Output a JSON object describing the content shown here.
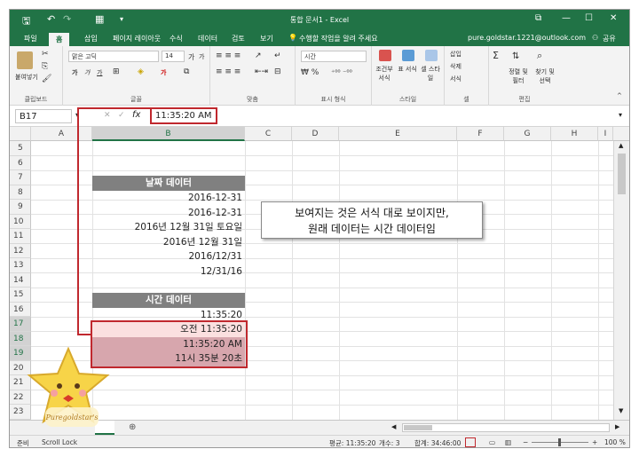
{
  "title_bar": {
    "document_title": "통합 문서1 - Excel",
    "window_buttons": [
      "restore-icon",
      "minimize-icon",
      "maximize-icon",
      "close-icon"
    ]
  },
  "ribbon_tabs": {
    "file": "파일",
    "home": "홈",
    "insert": "삽입",
    "layout": "페이지 레이아웃",
    "formulas": "수식",
    "data": "데이터",
    "review": "검토",
    "view": "보기",
    "tell_me": "수행할 작업을 알려 주세요",
    "account": "pure.goldstar.1221@outlook.com",
    "share": "공유"
  },
  "ribbon": {
    "clipboard": {
      "paste": "붙여넣기",
      "label": "클립보드"
    },
    "font": {
      "font_name": "맑은 고딕",
      "font_size": "14",
      "label": "글꼴",
      "bold": "가",
      "italic": "가",
      "underline": "가",
      "strike": "가",
      "grow": "가",
      "shrink": "가"
    },
    "alignment": {
      "label": "맞춤"
    },
    "number": {
      "format": "시간",
      "label": "표시 형식"
    },
    "styles": {
      "conditional": "조건부 서식",
      "table": "표 서식",
      "cell_styles": "셀 스타일",
      "label": "스타일"
    },
    "cells": {
      "insert": "삽입",
      "delete": "삭제",
      "format": "서식",
      "label": "셀"
    },
    "editing": {
      "sort": "정렬 및 필터",
      "find": "찾기 및 선택",
      "label": "편집"
    }
  },
  "formula_bar": {
    "name_box": "B17",
    "fx": "fx",
    "value": "11:35:20 AM"
  },
  "columns": [
    "A",
    "B",
    "C",
    "D",
    "E",
    "F",
    "G",
    "H",
    "I"
  ],
  "rows": [
    "5",
    "6",
    "7",
    "8",
    "9",
    "10",
    "11",
    "12",
    "13",
    "14",
    "15",
    "16",
    "17",
    "18",
    "19",
    "20",
    "21",
    "22",
    "23"
  ],
  "cells": {
    "r7": "날짜 데이터",
    "r8": "2016-12-31",
    "r9": "2016-12-31",
    "r10": "2016년 12월 31일 토요일",
    "r11": "2016년 12월 31일",
    "r12": "2016/12/31",
    "r13": "12/31/16",
    "r15": "시간 데이터",
    "r16": "11:35:20",
    "r17": "오전 11:35:20",
    "r18": "11:35:20 AM",
    "r19": "11시 35분 20초"
  },
  "callout": {
    "line1": "보여지는 것은 서식 대로 보이지만,",
    "line2": "원래 데이터는 시간 데이터임"
  },
  "sheet_tabs": {
    "add": "⊕"
  },
  "status_bar": {
    "ready": "준비",
    "scroll_lock": "Scroll Lock",
    "average": "평균: 11:35:20",
    "count": "개수: 3",
    "sum": "합계: 34:46:00",
    "zoom": "100 %"
  },
  "mascot": {
    "text": "Puregoldstar's"
  },
  "colors": {
    "accent": "#217346",
    "highlight": "#c0282e",
    "header_fill": "#808080",
    "row17_fill": "#fbe0e0",
    "row18_fill": "#d7a6ad"
  }
}
